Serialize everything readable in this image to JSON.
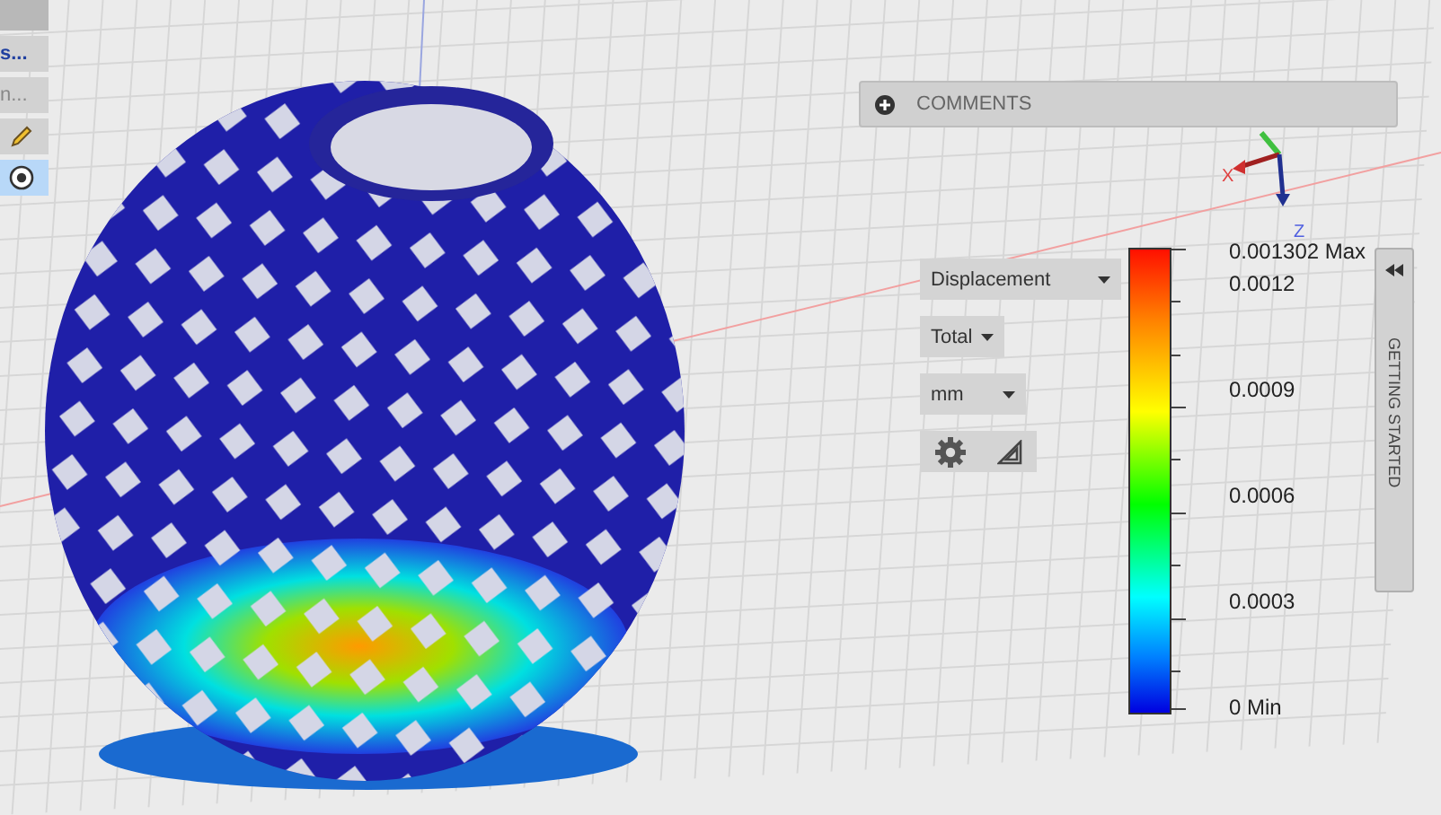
{
  "left_toolbar": [
    {
      "kind": "text",
      "label": "s...",
      "disabled": false,
      "selected": false
    },
    {
      "kind": "text",
      "label": "n...",
      "disabled": true,
      "selected": false
    },
    {
      "kind": "pencil",
      "selected": false
    },
    {
      "kind": "radio",
      "selected": true
    }
  ],
  "comments": {
    "label": "COMMENTS"
  },
  "axes": {
    "x_label": "X",
    "z_label": "Z"
  },
  "result_controls": {
    "result_type": "Displacement",
    "component": "Total",
    "unit": "mm"
  },
  "legend": {
    "labels": [
      "0.001302 Max",
      "0.0012",
      "0.0009",
      "0.0006",
      "0.0003",
      "0 Min"
    ]
  },
  "side_panel": {
    "label": "GETTING STARTED"
  }
}
